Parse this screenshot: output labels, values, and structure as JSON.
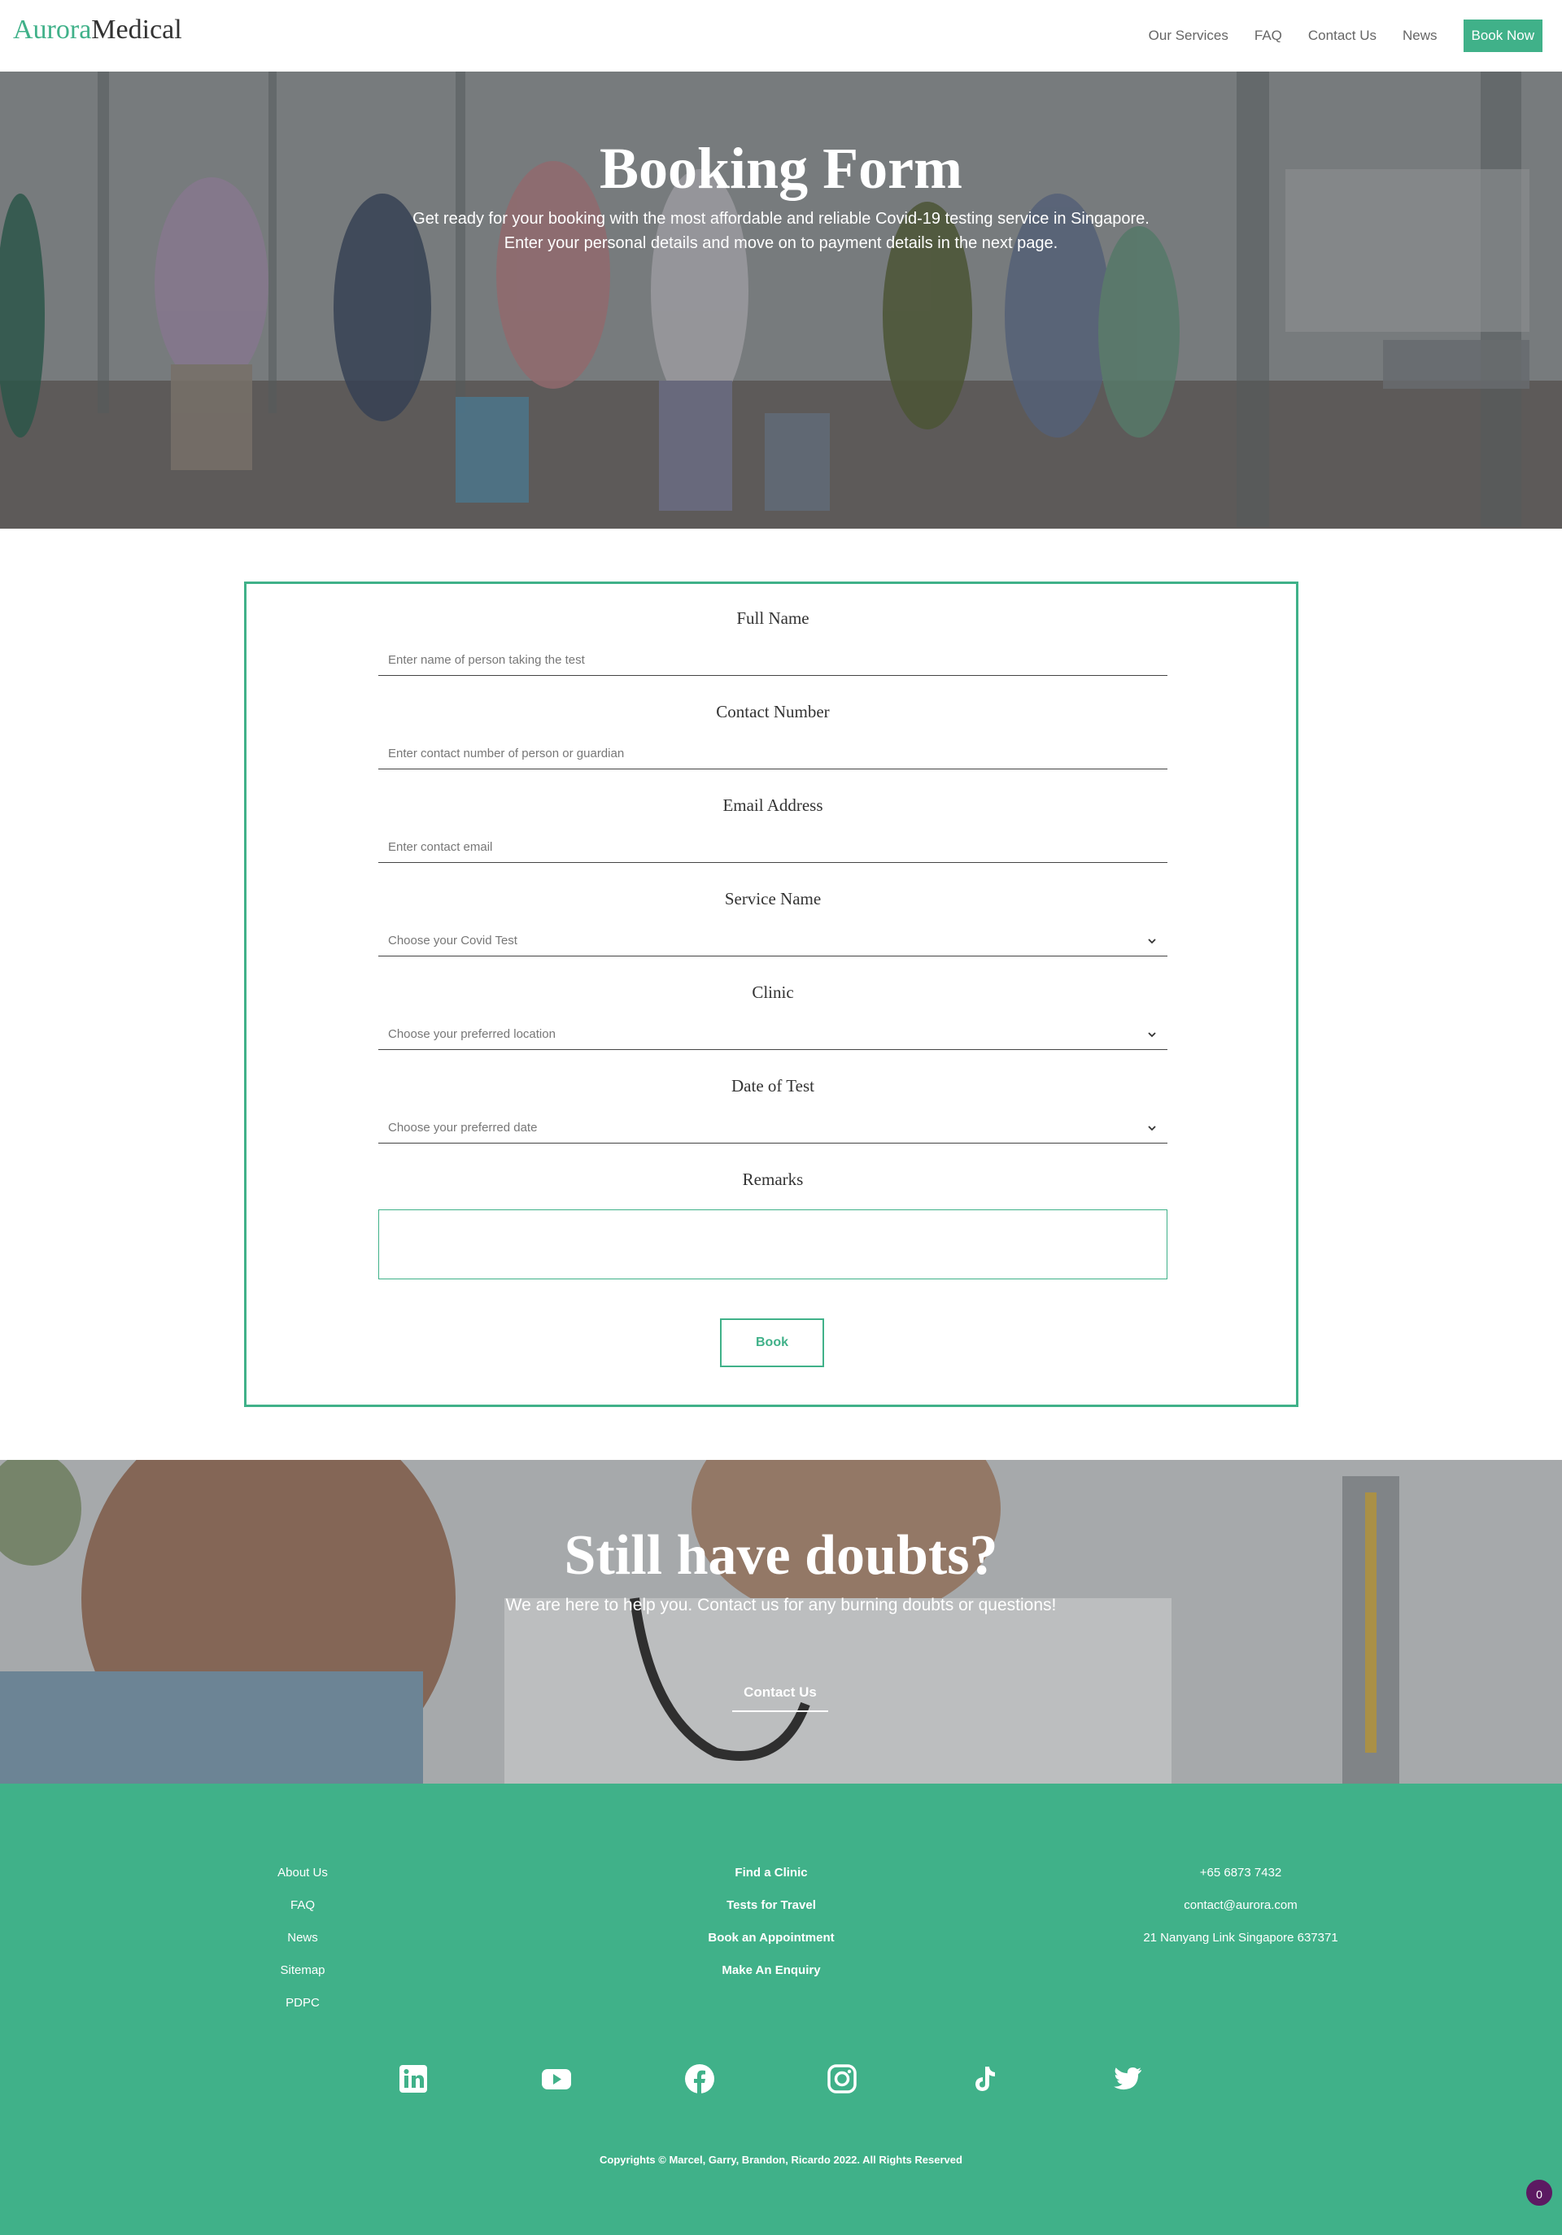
{
  "nav": {
    "logo_part1": "Aurora",
    "logo_part2": "Medical",
    "links": [
      "Our Services",
      "FAQ",
      "Contact Us",
      "News"
    ],
    "cta": "Book Now"
  },
  "hero": {
    "title": "Booking Form",
    "subtitle_line1": "Get ready for your booking with the most affordable and reliable Covid-19 testing service in Singapore.",
    "subtitle_line2": "Enter your personal details and move on to payment details in the next page."
  },
  "form": {
    "fields": [
      {
        "label": "Full Name",
        "placeholder": "Enter name of person taking the test",
        "type": "text"
      },
      {
        "label": "Contact Number",
        "placeholder": "Enter contact number of person or guardian",
        "type": "text"
      },
      {
        "label": "Email Address",
        "placeholder": "Enter contact email",
        "type": "text"
      },
      {
        "label": "Service Name",
        "placeholder": "Choose your Covid Test",
        "type": "select"
      },
      {
        "label": "Clinic",
        "placeholder": "Choose your preferred location",
        "type": "select"
      },
      {
        "label": "Date of Test",
        "placeholder": "Choose your preferred date",
        "type": "select"
      }
    ],
    "remarks_label": "Remarks",
    "remarks_value": "",
    "submit": "Book"
  },
  "cta": {
    "title": "Still have doubts?",
    "subtitle": "We are here to help you. Contact us for any burning doubts or questions!",
    "link": "Contact Us"
  },
  "footer": {
    "col1": [
      "About Us",
      "FAQ",
      "News",
      "Sitemap",
      "PDPC"
    ],
    "col2": [
      "Find a Clinic",
      "Tests for Travel",
      "Book an Appointment",
      "Make An Enquiry"
    ],
    "col3": [
      "+65 6873 7432",
      "contact@aurora.com",
      "21 Nanyang Link Singapore 637371"
    ],
    "socials": [
      "linkedin-icon",
      "youtube-icon",
      "facebook-icon",
      "instagram-icon",
      "tiktok-icon",
      "twitter-icon"
    ],
    "copyright": "Copyrights © Marcel, Garry, Brandon, Ricardo 2022. All Rights Reserved"
  },
  "chat_badge": "0",
  "colors": {
    "accent": "#40b189",
    "badge": "#5c1a62"
  }
}
